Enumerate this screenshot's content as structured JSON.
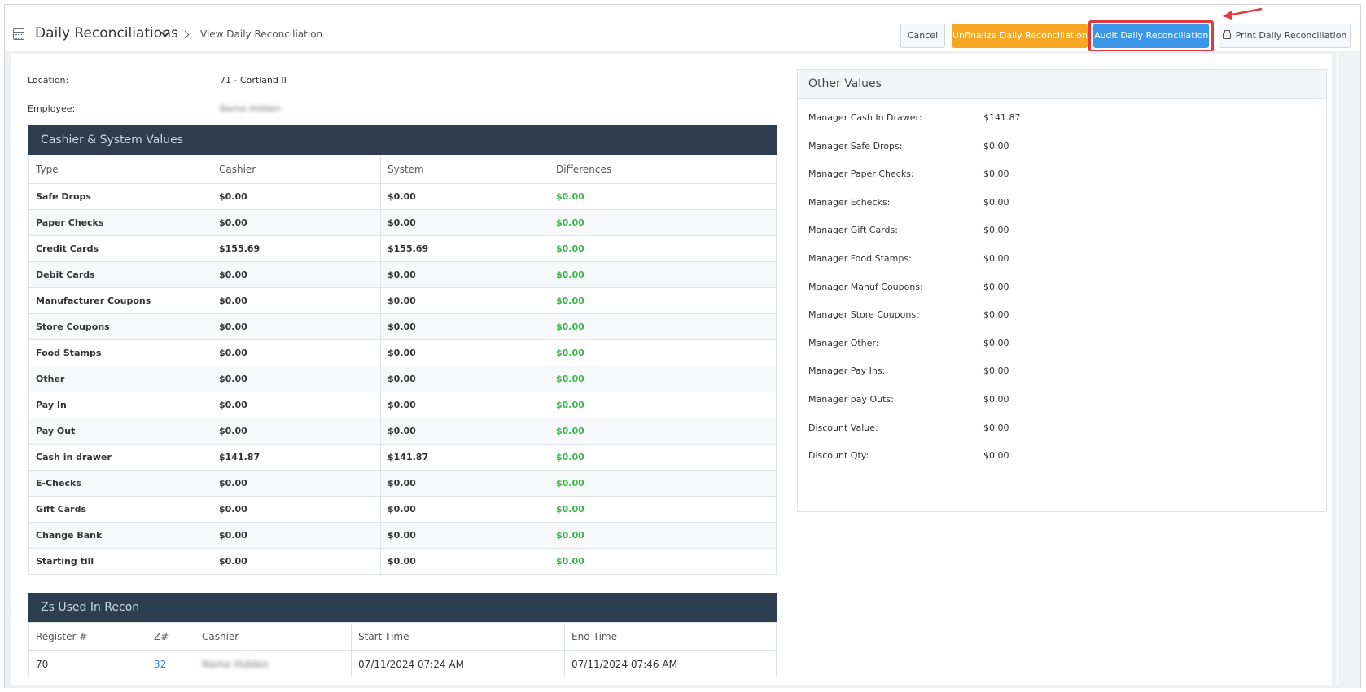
{
  "header": {
    "title": "Daily Reconciliations",
    "subtitle": "View Daily Reconciliation",
    "buttons": {
      "cancel": "Cancel",
      "unfinalize": "Unfinalize Daily Reconciliation",
      "audit": "Audit Daily Reconciliation",
      "print": "Print Daily Reconciliation"
    }
  },
  "info": {
    "location_label": "Location:",
    "location_value": "71 - Cortland II",
    "employee_label": "Employee:",
    "employee_value": "Name Hidden"
  },
  "cashier_panel": {
    "title": "Cashier & System Values",
    "columns": [
      "Type",
      "Cashier",
      "System",
      "Differences"
    ],
    "rows": [
      [
        "Safe Drops",
        "$0.00",
        "$0.00",
        "$0.00"
      ],
      [
        "Paper Checks",
        "$0.00",
        "$0.00",
        "$0.00"
      ],
      [
        "Credit Cards",
        "$155.69",
        "$155.69",
        "$0.00"
      ],
      [
        "Debit Cards",
        "$0.00",
        "$0.00",
        "$0.00"
      ],
      [
        "Manufacturer Coupons",
        "$0.00",
        "$0.00",
        "$0.00"
      ],
      [
        "Store Coupons",
        "$0.00",
        "$0.00",
        "$0.00"
      ],
      [
        "Food Stamps",
        "$0.00",
        "$0.00",
        "$0.00"
      ],
      [
        "Other",
        "$0.00",
        "$0.00",
        "$0.00"
      ],
      [
        "Pay In",
        "$0.00",
        "$0.00",
        "$0.00"
      ],
      [
        "Pay Out",
        "$0.00",
        "$0.00",
        "$0.00"
      ],
      [
        "Cash in drawer",
        "$141.87",
        "$141.87",
        "$0.00"
      ],
      [
        "E-Checks",
        "$0.00",
        "$0.00",
        "$0.00"
      ],
      [
        "Gift Cards",
        "$0.00",
        "$0.00",
        "$0.00"
      ],
      [
        "Change Bank",
        "$0.00",
        "$0.00",
        "$0.00"
      ],
      [
        "Starting till",
        "$0.00",
        "$0.00",
        "$0.00"
      ]
    ]
  },
  "zs_panel": {
    "title": "Zs Used In Recon",
    "columns": [
      "Register #",
      "Z#",
      "Cashier",
      "Start Time",
      "End Time"
    ],
    "rows": [
      [
        "70",
        "32",
        "Name Hidden",
        "07/11/2024 07:24 AM",
        "07/11/2024 07:46 AM"
      ]
    ]
  },
  "other_values": {
    "title": "Other Values",
    "rows": [
      [
        "Manager Cash In Drawer:",
        "$141.87"
      ],
      [
        "Manager Safe Drops:",
        "$0.00"
      ],
      [
        "Manager Paper Checks:",
        "$0.00"
      ],
      [
        "Manager Echecks:",
        "$0.00"
      ],
      [
        "Manager Gift Cards:",
        "$0.00"
      ],
      [
        "Manager Food Stamps:",
        "$0.00"
      ],
      [
        "Manager Manuf Coupons:",
        "$0.00"
      ],
      [
        "Manager Store Coupons:",
        "$0.00"
      ],
      [
        "Manager Other:",
        "$0.00"
      ],
      [
        "Manager Pay Ins:",
        "$0.00"
      ],
      [
        "Manager pay Outs:",
        "$0.00"
      ],
      [
        "Discount Value:",
        "$0.00"
      ],
      [
        "Discount Qty:",
        "$0.00"
      ]
    ]
  },
  "colors": {
    "panel_header": "#2d3e50",
    "accent_audit": "#3c96e8",
    "accent_unfinalize": "#f5a623",
    "highlight": "#e0393e",
    "difference_green": "#3bb34a"
  }
}
